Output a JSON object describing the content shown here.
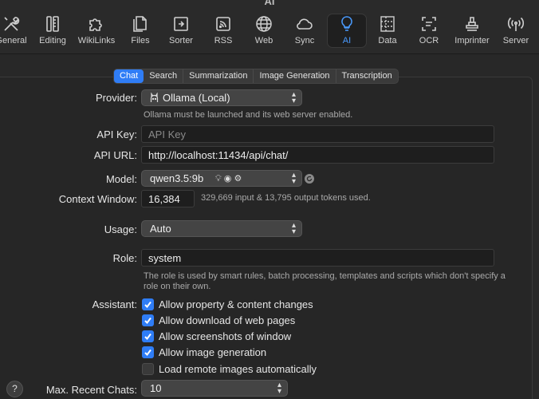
{
  "window": {
    "title": "AI"
  },
  "toolbar": {
    "items": [
      {
        "label": "General",
        "icon": "wrench-screwdriver-icon"
      },
      {
        "label": "Editing",
        "icon": "pencil-ruler-icon"
      },
      {
        "label": "WikiLinks",
        "icon": "puzzle-icon"
      },
      {
        "label": "Files",
        "icon": "files-icon"
      },
      {
        "label": "Sorter",
        "icon": "sorter-tray-icon"
      },
      {
        "label": "RSS",
        "icon": "rss-icon"
      },
      {
        "label": "Web",
        "icon": "globe-icon"
      },
      {
        "label": "Sync",
        "icon": "cloud-icon"
      },
      {
        "label": "AI",
        "icon": "lightbulb-icon"
      },
      {
        "label": "Data",
        "icon": "data-grid-icon"
      },
      {
        "label": "OCR",
        "icon": "ocr-scan-icon"
      },
      {
        "label": "Imprinter",
        "icon": "stamp-icon"
      },
      {
        "label": "Server",
        "icon": "antenna-icon"
      }
    ],
    "active": "AI"
  },
  "tabs": [
    "Chat",
    "Search",
    "Summarization",
    "Image Generation",
    "Transcription"
  ],
  "form": {
    "provider_label": "Provider:",
    "provider_value": "Ollama (Local)",
    "provider_note": "Ollama must be launched and its web server enabled.",
    "api_key_label": "API Key:",
    "api_key_placeholder": "API Key",
    "api_url_label": "API URL:",
    "api_url_value": "http://localhost:11434/api/chat/",
    "model_label": "Model:",
    "model_value": "qwen3.5:9b",
    "context_label": "Context Window:",
    "context_value": "16,384",
    "context_note": "329,669 input & 13,795 output tokens used.",
    "usage_label": "Usage:",
    "usage_value": "Auto",
    "role_label": "Role:",
    "role_value": "system",
    "role_note_line1": "The role is used by smart rules, batch processing, templates and scripts which don't specify a",
    "role_note_line2": "role on their own.",
    "assistant_label": "Assistant:",
    "assistant_options": [
      {
        "label": "Allow property & content changes",
        "checked": true
      },
      {
        "label": "Allow download of web pages",
        "checked": true
      },
      {
        "label": "Allow screenshots of window",
        "checked": true
      },
      {
        "label": "Allow image generation",
        "checked": true
      },
      {
        "label": "Load remote images automatically",
        "checked": false
      }
    ],
    "max_chats_label": "Max. Recent Chats:",
    "max_chats_value": "10"
  },
  "help": {
    "label": "?"
  },
  "colors": {
    "accent": "#2f7df6",
    "active_icon": "#4a9bff",
    "background": "#282828"
  }
}
